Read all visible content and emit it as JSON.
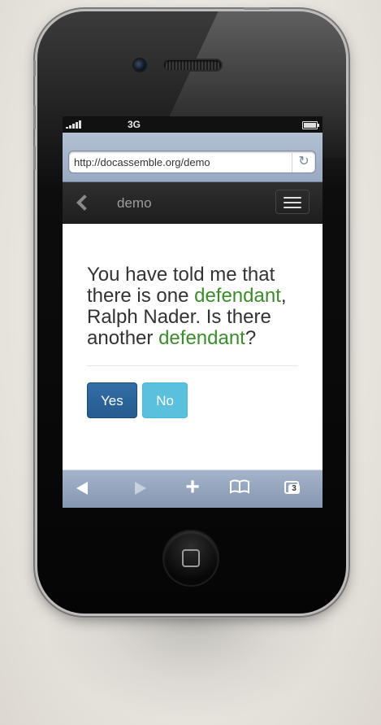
{
  "status_bar": {
    "network": "3G",
    "signal_bars": 5
  },
  "browser": {
    "url": "http://docassemble.org/demo"
  },
  "navbar": {
    "title": "demo"
  },
  "question": {
    "part1": "You have told me that there is one ",
    "term1": "defendant",
    "part2": ", Ralph Nader. Is there another ",
    "term2": "defendant",
    "part3": "?"
  },
  "buttons": {
    "yes_label": "Yes",
    "no_label": "No"
  },
  "toolbar": {
    "tabs_count": "3"
  },
  "colors": {
    "term_green": "#3b8c2b",
    "yes_button": "#2a6496",
    "no_button": "#5bc0de",
    "navbar": "#222222",
    "toolbar": "#94a4bd"
  },
  "icons": {
    "reload": "reload-icon",
    "back": "chevron-left-icon",
    "menu": "hamburger-menu-icon",
    "bookmarks": "open-book-icon",
    "tabs": "tabs-icon",
    "add": "plus-icon"
  }
}
